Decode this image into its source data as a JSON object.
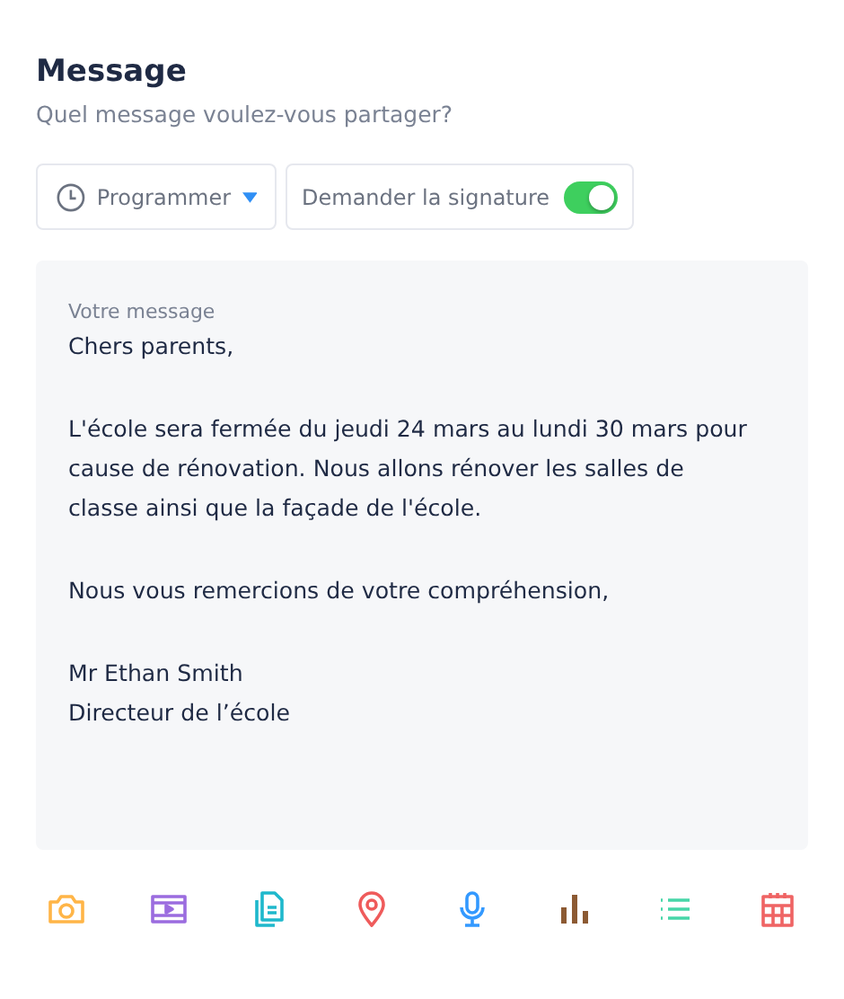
{
  "header": {
    "title": "Message",
    "subtitle": "Quel message voulez-vous partager?"
  },
  "controls": {
    "schedule": {
      "label": "Programmer"
    },
    "signature": {
      "label": "Demander la signature",
      "on": true
    }
  },
  "message": {
    "label": "Votre message",
    "paragraphs": [
      [
        "Chers parents,"
      ],
      [
        "L'école sera fermée du jeudi 24 mars au lundi 30 mars pour",
        "cause de rénovation. Nous allons rénover les salles de",
        "classe ainsi que la façade de l'école."
      ],
      [
        "Nous vous remercions de votre compréhension,"
      ],
      [
        "Mr Ethan Smith",
        "Directeur de l’école"
      ]
    ]
  },
  "attachments": [
    {
      "kind": "camera",
      "color": "#ffb547"
    },
    {
      "kind": "video",
      "color": "#9b6cdf"
    },
    {
      "kind": "document",
      "color": "#1fb8cc"
    },
    {
      "kind": "location",
      "color": "#ef5b5b"
    },
    {
      "kind": "microphone",
      "color": "#3399ff"
    },
    {
      "kind": "chart",
      "color": "#8c5a33"
    },
    {
      "kind": "list",
      "color": "#47d6a8"
    },
    {
      "kind": "calendar",
      "color": "#ef6464"
    }
  ]
}
